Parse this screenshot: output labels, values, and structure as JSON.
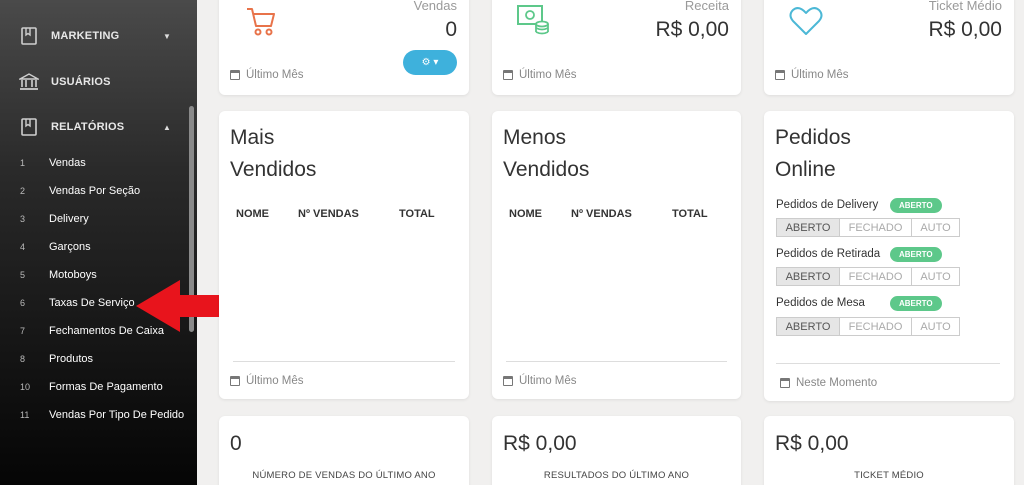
{
  "sidebar": {
    "marketing": {
      "label": "MARKETING",
      "icon": "book-icon"
    },
    "usuarios": {
      "label": "USUÁRIOS",
      "icon": "bank-icon"
    },
    "relatorios": {
      "label": "RELATÓRIOS",
      "icon": "book-icon"
    },
    "sub_items": [
      {
        "num": "1",
        "label": "Vendas"
      },
      {
        "num": "2",
        "label": "Vendas Por Seção"
      },
      {
        "num": "3",
        "label": "Delivery"
      },
      {
        "num": "4",
        "label": "Garçons"
      },
      {
        "num": "5",
        "label": "Motoboys"
      },
      {
        "num": "6",
        "label": "Taxas De Serviço"
      },
      {
        "num": "7",
        "label": "Fechamentos De Caixa"
      },
      {
        "num": "8",
        "label": "Produtos"
      },
      {
        "num": "10",
        "label": "Formas De Pagamento"
      },
      {
        "num": "11",
        "label": "Vendas Por Tipo De Pedido"
      }
    ]
  },
  "stats": {
    "vendas": {
      "label": "Vendas",
      "value": "0",
      "footer": "Último Mês",
      "icon": "cart-icon",
      "color": "#e8734a"
    },
    "receita": {
      "label": "Receita",
      "value": "R$ 0,00",
      "footer": "Último Mês",
      "icon": "money-icon",
      "color": "#5dc88a"
    },
    "ticket": {
      "label": "Ticket Médio",
      "value": "R$ 0,00",
      "footer": "Último Mês",
      "icon": "heart-icon",
      "color": "#4cb8d6"
    }
  },
  "mais_vendidos": {
    "title_line1": "Mais",
    "title_line2": "Vendidos",
    "columns": [
      "NOME",
      "Nº VENDAS",
      "TOTAL"
    ],
    "footer": "Último Mês"
  },
  "menos_vendidos": {
    "title_line1": "Menos",
    "title_line2": "Vendidos",
    "columns": [
      "NOME",
      "Nº VENDAS",
      "TOTAL"
    ],
    "footer": "Último Mês"
  },
  "pedidos_online": {
    "title_line1": "Pedidos",
    "title_line2": "Online",
    "rows": [
      {
        "label": "Pedidos de Delivery",
        "status": "ABERTO"
      },
      {
        "label": "Pedidos de Retirada",
        "status": "ABERTO"
      },
      {
        "label": "Pedidos de Mesa",
        "status": "ABERTO"
      }
    ],
    "options": [
      "ABERTO",
      "FECHADO",
      "AUTO"
    ],
    "footer": "Neste Momento"
  },
  "bottom": {
    "vendas_ano": {
      "value": "0",
      "caption": "NÚMERO DE VENDAS DO ÚLTIMO ANO"
    },
    "resultados_ano": {
      "value": "R$ 0,00",
      "caption": "RESULTADOS DO ÚLTIMO ANO"
    },
    "ticket_medio": {
      "value": "R$ 0,00",
      "caption": "TICKET MÉDIO"
    }
  },
  "colors": {
    "accent_blue": "#3eb1dc",
    "status_green": "#5dc88a",
    "arrow_red": "#e8141c"
  }
}
